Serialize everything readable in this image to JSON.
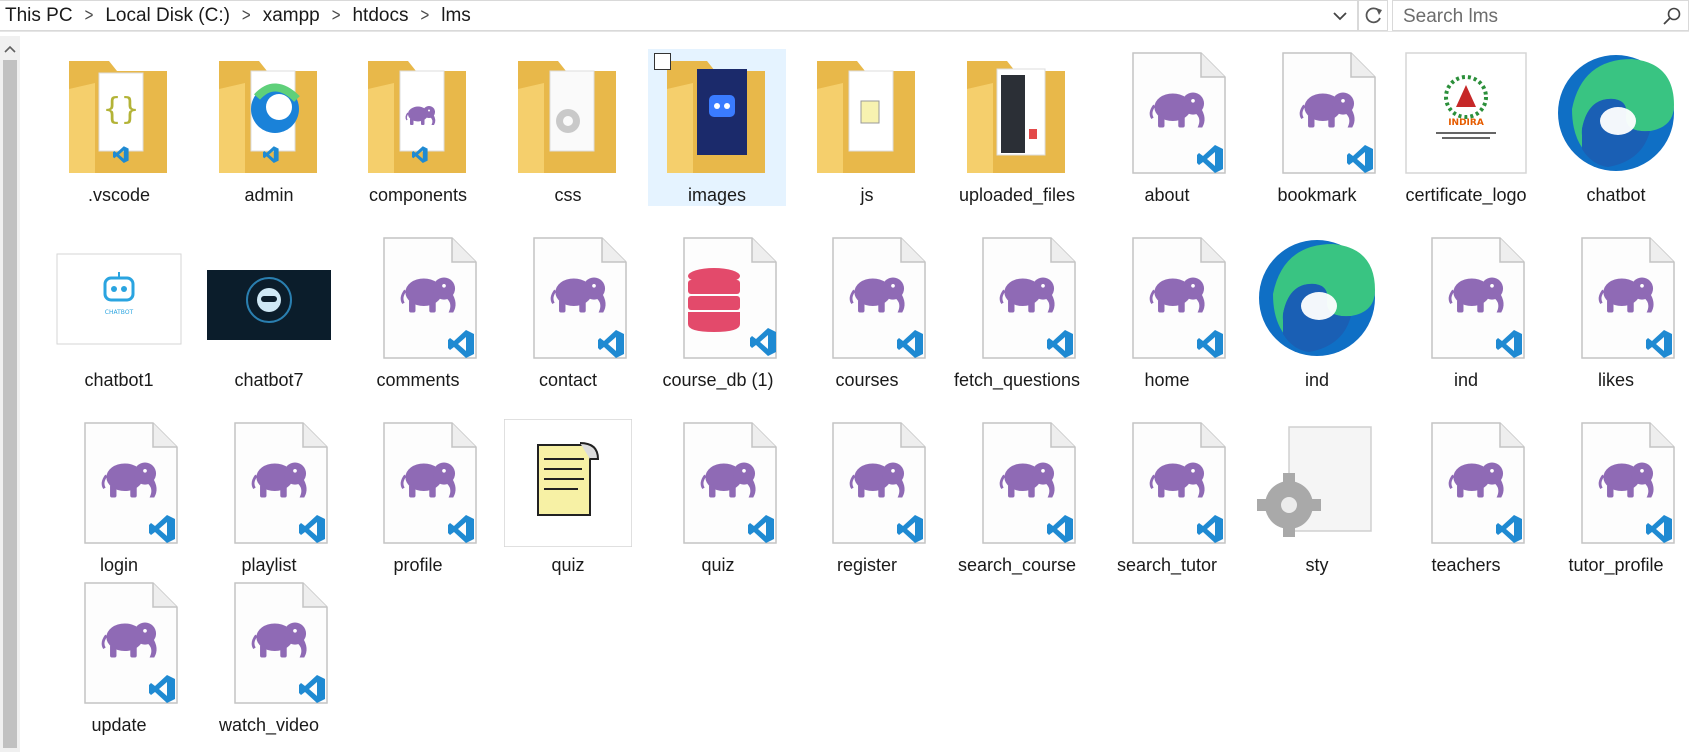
{
  "breadcrumb": [
    "This PC",
    "Local Disk (C:)",
    "xampp",
    "htdocs",
    "lms"
  ],
  "search": {
    "placeholder": "Search lms"
  },
  "items": [
    {
      "label": ".vscode",
      "icon": "folder-vscode-icon"
    },
    {
      "label": "admin",
      "icon": "folder-edge-icon"
    },
    {
      "label": "components",
      "icon": "folder-php-icon"
    },
    {
      "label": "css",
      "icon": "folder-gear-icon"
    },
    {
      "label": "images",
      "icon": "folder-image-icon",
      "selected": true
    },
    {
      "label": "js",
      "icon": "folder-js-icon"
    },
    {
      "label": "uploaded_files",
      "icon": "folder-screenshot-icon"
    },
    {
      "label": "about",
      "icon": "php-file-icon"
    },
    {
      "label": "bookmark",
      "icon": "php-file-icon"
    },
    {
      "label": "certificate_logo",
      "icon": "certificate-image-icon",
      "thumb_caption": "INDIRA"
    },
    {
      "label": "chatbot",
      "icon": "edge-icon"
    },
    {
      "label": "chatbot1",
      "icon": "chatbot-image-icon",
      "thumb_caption": "CHATBOT"
    },
    {
      "label": "chatbot7",
      "icon": "chatbot-dark-image-icon"
    },
    {
      "label": "comments",
      "icon": "php-file-icon"
    },
    {
      "label": "contact",
      "icon": "php-file-icon"
    },
    {
      "label": "course_db (1)",
      "icon": "database-file-icon"
    },
    {
      "label": "courses",
      "icon": "php-file-icon"
    },
    {
      "label": "fetch_questions",
      "icon": "php-file-icon"
    },
    {
      "label": "home",
      "icon": "php-file-icon"
    },
    {
      "label": "ind",
      "icon": "edge-icon"
    },
    {
      "label": "ind",
      "icon": "php-file-icon"
    },
    {
      "label": "likes",
      "icon": "php-file-icon"
    },
    {
      "label": "login",
      "icon": "php-file-icon"
    },
    {
      "label": "playlist",
      "icon": "php-file-icon"
    },
    {
      "label": "profile",
      "icon": "php-file-icon"
    },
    {
      "label": "quiz",
      "icon": "script-file-icon"
    },
    {
      "label": "quiz",
      "icon": "php-file-icon"
    },
    {
      "label": "register",
      "icon": "php-file-icon"
    },
    {
      "label": "search_course",
      "icon": "php-file-icon"
    },
    {
      "label": "search_tutor",
      "icon": "php-file-icon"
    },
    {
      "label": "sty",
      "icon": "settings-file-icon"
    },
    {
      "label": "teachers",
      "icon": "php-file-icon"
    },
    {
      "label": "tutor_profile",
      "icon": "php-file-icon"
    },
    {
      "label": "update",
      "icon": "php-file-icon"
    },
    {
      "label": "watch_video",
      "icon": "php-file-icon"
    }
  ],
  "colors": {
    "selection": "#e5f3ff",
    "folder": "#f8d775",
    "php_elephant": "#8f6ab5",
    "vscode_blue": "#1f8ad2",
    "database_red": "#e34a6b"
  }
}
